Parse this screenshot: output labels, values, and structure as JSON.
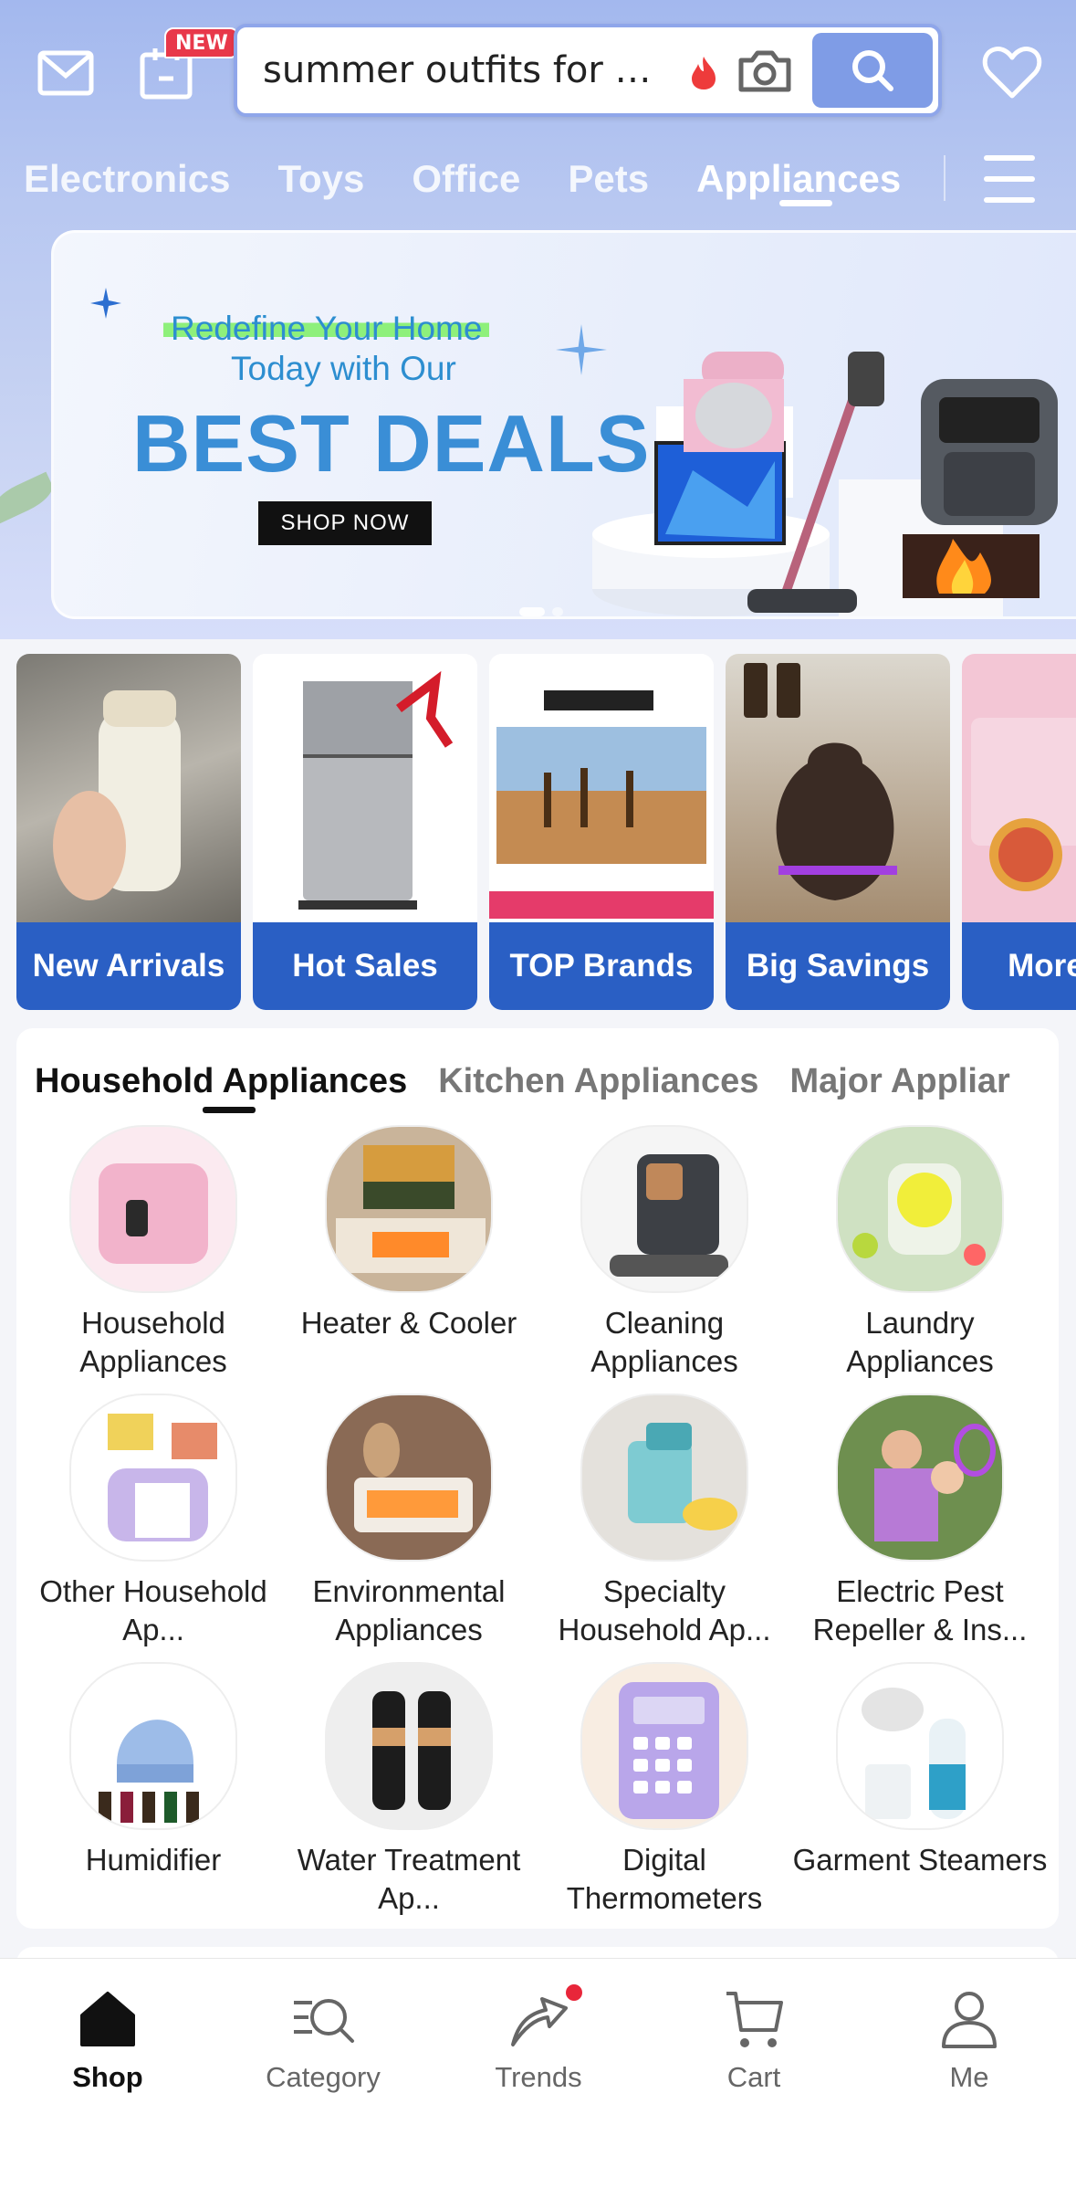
{
  "header": {
    "new_badge": "NEW",
    "search_text": "summer outfits for w...",
    "icons": [
      "mail-icon",
      "calendar-icon",
      "fire-icon",
      "camera-icon",
      "search-icon",
      "heart-icon"
    ]
  },
  "category_tabs": [
    {
      "label": "Electronics"
    },
    {
      "label": "Toys"
    },
    {
      "label": "Office"
    },
    {
      "label": "Pets"
    },
    {
      "label": "Appliances",
      "active": true
    }
  ],
  "banner": {
    "line1": "Redefine Your Home",
    "line2": "Today with Our",
    "title": "BEST DEALS",
    "button": "SHOP NOW"
  },
  "promos": [
    {
      "label": "New Arrivals"
    },
    {
      "label": "Hot Sales"
    },
    {
      "label": "TOP Brands"
    },
    {
      "label": "Big Savings"
    },
    {
      "label": "More Thi"
    }
  ],
  "sub_tabs": [
    {
      "label": "Household Appliances",
      "active": true
    },
    {
      "label": "Kitchen Appliances"
    },
    {
      "label": "Major Appliar"
    }
  ],
  "categories": [
    {
      "name": "Household Appliances"
    },
    {
      "name": "Heater & Cooler"
    },
    {
      "name": "Cleaning Appliances"
    },
    {
      "name": "Laundry Appliances"
    },
    {
      "name": "Other Household Ap..."
    },
    {
      "name": "Environmental Appliances"
    },
    {
      "name": "Specialty Household Ap..."
    },
    {
      "name": "Electric Pest Repeller & Ins..."
    },
    {
      "name": "Humidifier"
    },
    {
      "name": "Water Treatment Ap..."
    },
    {
      "name": "Digital Thermometers"
    },
    {
      "name": "Garment Steamers"
    }
  ],
  "bottom_nav": [
    {
      "label": "Shop",
      "active": true
    },
    {
      "label": "Category"
    },
    {
      "label": "Trends"
    },
    {
      "label": "Cart"
    },
    {
      "label": "Me"
    }
  ],
  "colors": {
    "accent": "#2a5fc4",
    "search_button": "#7f9ce6",
    "badge_red": "#e8384a"
  }
}
